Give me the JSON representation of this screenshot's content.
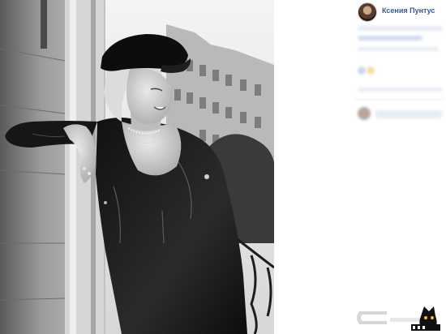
{
  "post": {
    "author_name": "Ксения Пунтус"
  },
  "photo": {
    "description_icon": "photo-image",
    "style": "black-and-white"
  },
  "colors": {
    "author_link": "#385898",
    "panel_bg": "#ffffff",
    "blurred_text": "#e8ecf4"
  }
}
